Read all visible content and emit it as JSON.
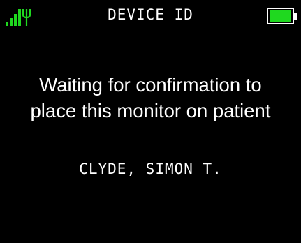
{
  "status_bar": {
    "title": "DEVICE ID",
    "signal_icon": "signal-antenna-icon",
    "battery_icon": "battery-full-icon",
    "signal_color": "#1fd81f",
    "battery_color": "#1fd81f"
  },
  "main": {
    "message_line_1": "Waiting for confirmation to",
    "message_line_2": "place this monitor on patient",
    "patient_name": "CLYDE, SIMON T."
  }
}
